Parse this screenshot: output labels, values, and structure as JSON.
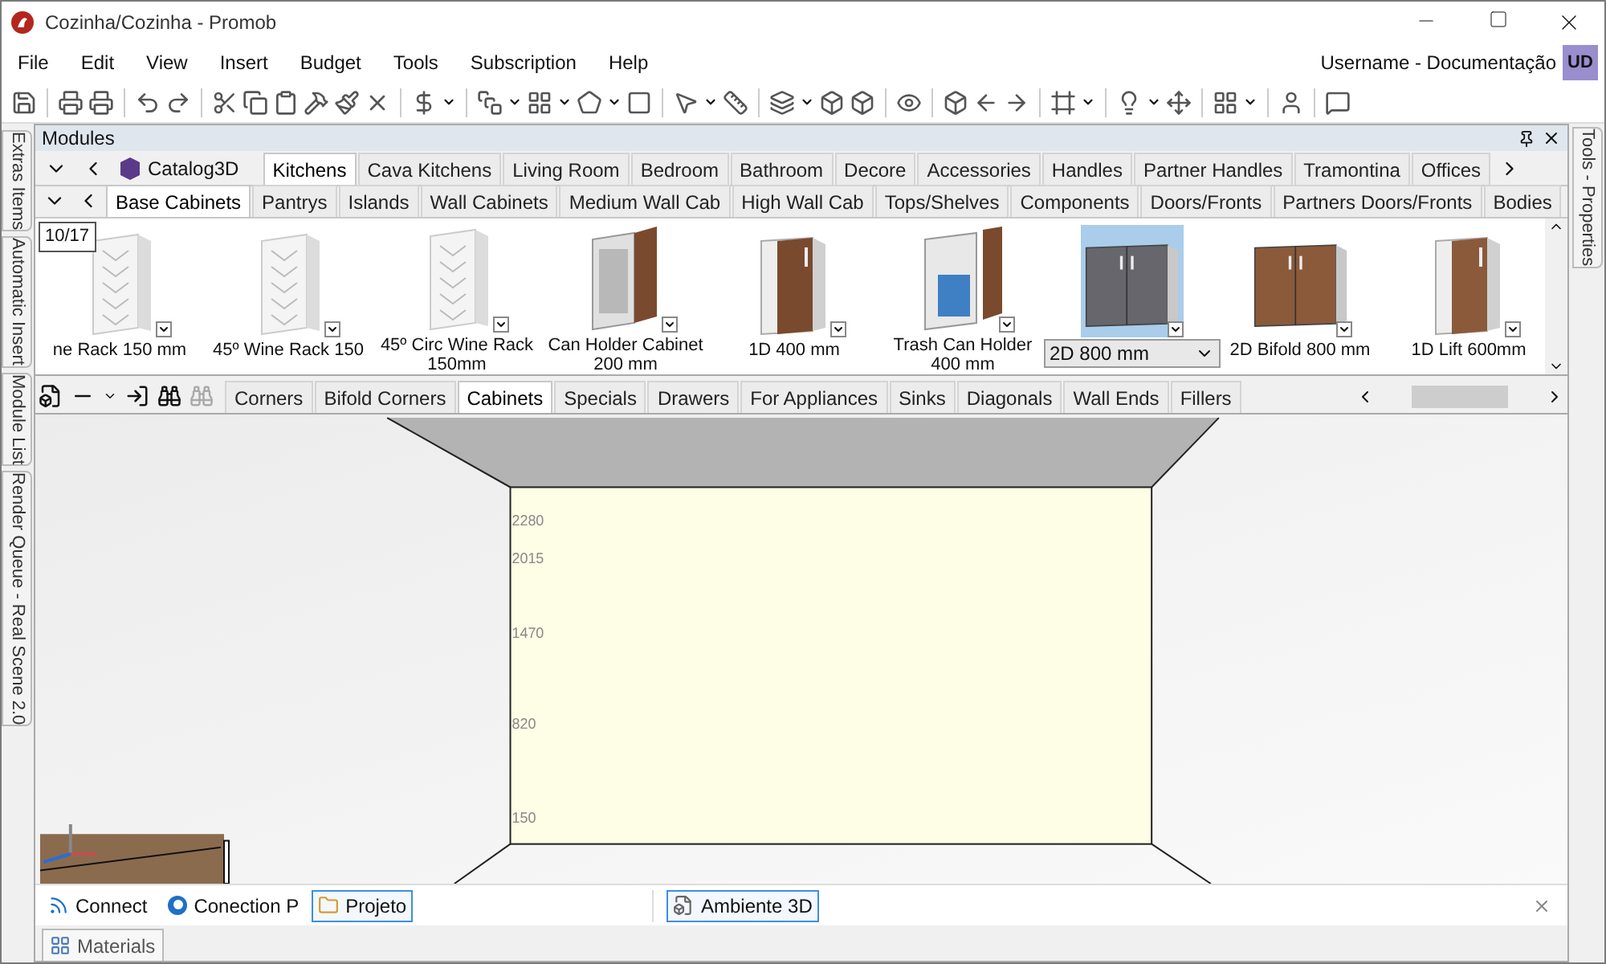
{
  "window": {
    "title": "Cozinha/Cozinha - Promob"
  },
  "menu": [
    "File",
    "Edit",
    "View",
    "Insert",
    "Budget",
    "Tools",
    "Subscription",
    "Help"
  ],
  "user": {
    "name": "Username - Documentação",
    "initials": "UD"
  },
  "left_dock": [
    {
      "label": "Extras Items"
    },
    {
      "label": "Automatic Insert"
    },
    {
      "label": "Module List"
    },
    {
      "label": "Render Queue - Real Scene 2.0"
    }
  ],
  "right_dock": [
    {
      "label": "Tools - Properties"
    }
  ],
  "modules": {
    "title": "Modules",
    "catalog": "Catalog3D",
    "categories": [
      {
        "label": "Kitchens",
        "selected": true
      },
      {
        "label": "Cava Kitchens",
        "selected": false
      },
      {
        "label": "Living Room",
        "selected": false
      },
      {
        "label": "Bedroom",
        "selected": false
      },
      {
        "label": "Bathroom",
        "selected": false
      },
      {
        "label": "Decore",
        "selected": false
      },
      {
        "label": "Accessories",
        "selected": false
      },
      {
        "label": "Handles",
        "selected": false
      },
      {
        "label": "Partner Handles",
        "selected": false
      },
      {
        "label": "Tramontina",
        "selected": false
      },
      {
        "label": "Offices",
        "selected": false
      }
    ],
    "groups": [
      {
        "label": "Base Cabinets",
        "selected": true
      },
      {
        "label": "Pantrys",
        "selected": false
      },
      {
        "label": "Islands",
        "selected": false
      },
      {
        "label": "Wall Cabinets",
        "selected": false
      },
      {
        "label": "Medium Wall Cab",
        "selected": false
      },
      {
        "label": "High Wall Cab",
        "selected": false
      },
      {
        "label": "Tops/Shelves",
        "selected": false
      },
      {
        "label": "Components",
        "selected": false
      },
      {
        "label": "Doors/Fronts",
        "selected": false
      },
      {
        "label": "Partners Doors/Fronts",
        "selected": false
      },
      {
        "label": "Bodies",
        "selected": false
      }
    ],
    "counter": "10/17",
    "items": [
      {
        "label": "ne Rack 150 mm",
        "kind": "rack",
        "selected": false
      },
      {
        "label": "45º Wine Rack 150",
        "kind": "rack",
        "selected": false
      },
      {
        "label": "45º Circ Wine Rack 150mm",
        "kind": "rack",
        "selected": false
      },
      {
        "label": "Can Holder Cabinet 200 mm",
        "kind": "holder",
        "color": "#7a4a2e",
        "selected": false
      },
      {
        "label": "1D 400 mm",
        "kind": "door",
        "color": "#7a4a2e",
        "selected": false
      },
      {
        "label": "Trash Can Holder 400 mm",
        "kind": "bin",
        "color": "#7a4a2e",
        "selected": false
      },
      {
        "label": "2D 800 mm",
        "kind": "double",
        "color": "#66666c",
        "selected": true
      },
      {
        "label": "2D Bifold 800 mm",
        "kind": "double",
        "color": "#8b5a3a",
        "selected": false
      },
      {
        "label": "1D Lift 600mm",
        "kind": "door",
        "color": "#8b5a3a",
        "selected": false
      }
    ],
    "subgroups": [
      {
        "label": "Corners",
        "selected": false
      },
      {
        "label": "Bifold Corners",
        "selected": false
      },
      {
        "label": "Cabinets",
        "selected": true
      },
      {
        "label": "Specials",
        "selected": false
      },
      {
        "label": "Drawers",
        "selected": false
      },
      {
        "label": "For Appliances",
        "selected": false
      },
      {
        "label": "Sinks",
        "selected": false
      },
      {
        "label": "Diagonals",
        "selected": false
      },
      {
        "label": "Wall Ends",
        "selected": false
      },
      {
        "label": "Fillers",
        "selected": false
      }
    ]
  },
  "view": {
    "ruler": [
      "2280",
      "2015",
      "1470",
      "820",
      "150"
    ]
  },
  "panel_tabs": [
    {
      "label": "Connect",
      "kind": "feed",
      "selected": false
    },
    {
      "label": "Conection P",
      "kind": "logo",
      "selected": false
    },
    {
      "label": "Projeto",
      "kind": "folder",
      "selected": true
    }
  ],
  "document_tabs": [
    {
      "label": "Ambiente 3D",
      "selected": true
    }
  ],
  "bottom_tabs": [
    {
      "label": "Materials"
    }
  ]
}
